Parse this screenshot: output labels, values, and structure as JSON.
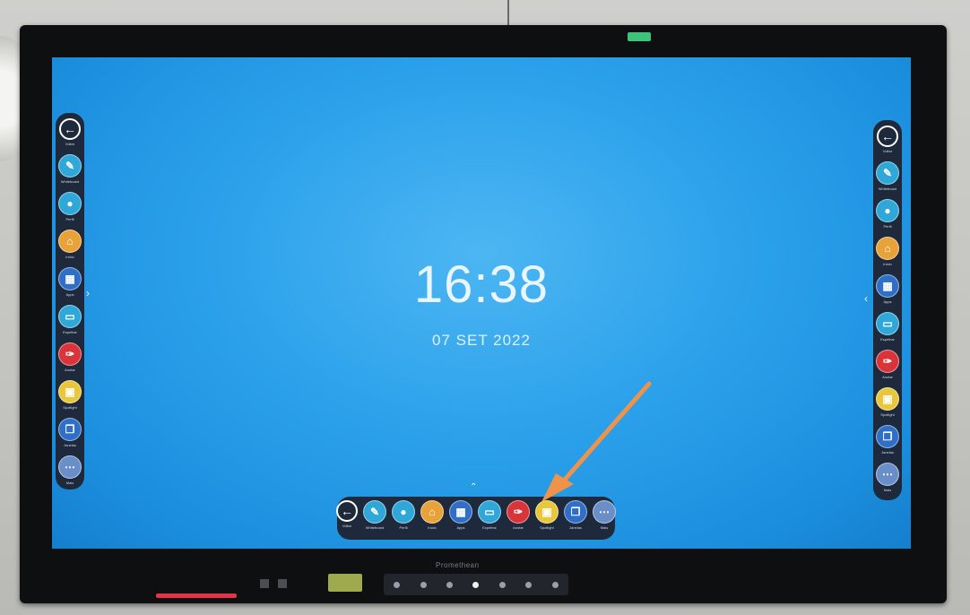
{
  "screen": {
    "time": "16:38",
    "date": "07 SET 2022"
  },
  "brand_label": "Promethean",
  "toolbar_tools": [
    {
      "name": "back",
      "glyph": "←",
      "color": "#1e2a3c",
      "label": "Voltar"
    },
    {
      "name": "whiteboard",
      "glyph": "✎",
      "color": "#2fa7d8",
      "label": "Whiteboard"
    },
    {
      "name": "user",
      "glyph": "●",
      "color": "#2fa7d8",
      "label": "Perfil"
    },
    {
      "name": "home",
      "glyph": "⌂",
      "color": "#e8a23a",
      "label": "Início"
    },
    {
      "name": "apps",
      "glyph": "▦",
      "color": "#2f6fc8",
      "label": "Apps"
    },
    {
      "name": "screen-share",
      "glyph": "▭",
      "color": "#2fa7d8",
      "label": "Espelhar"
    },
    {
      "name": "annotate",
      "glyph": "✑",
      "color": "#d8343a",
      "label": "Anotar"
    },
    {
      "name": "spotlight",
      "glyph": "▣",
      "color": "#e8c83a",
      "label": "Spotlight"
    },
    {
      "name": "windows",
      "glyph": "❐",
      "color": "#2f6fc8",
      "label": "Janelas"
    },
    {
      "name": "more",
      "glyph": "⋯",
      "color": "#6a8fc8",
      "label": "Mais"
    }
  ],
  "colors": {
    "arrow": "#f0934a",
    "screen_blue": "#2ea3ec",
    "toolbar_bg": "#1e2a3c"
  }
}
